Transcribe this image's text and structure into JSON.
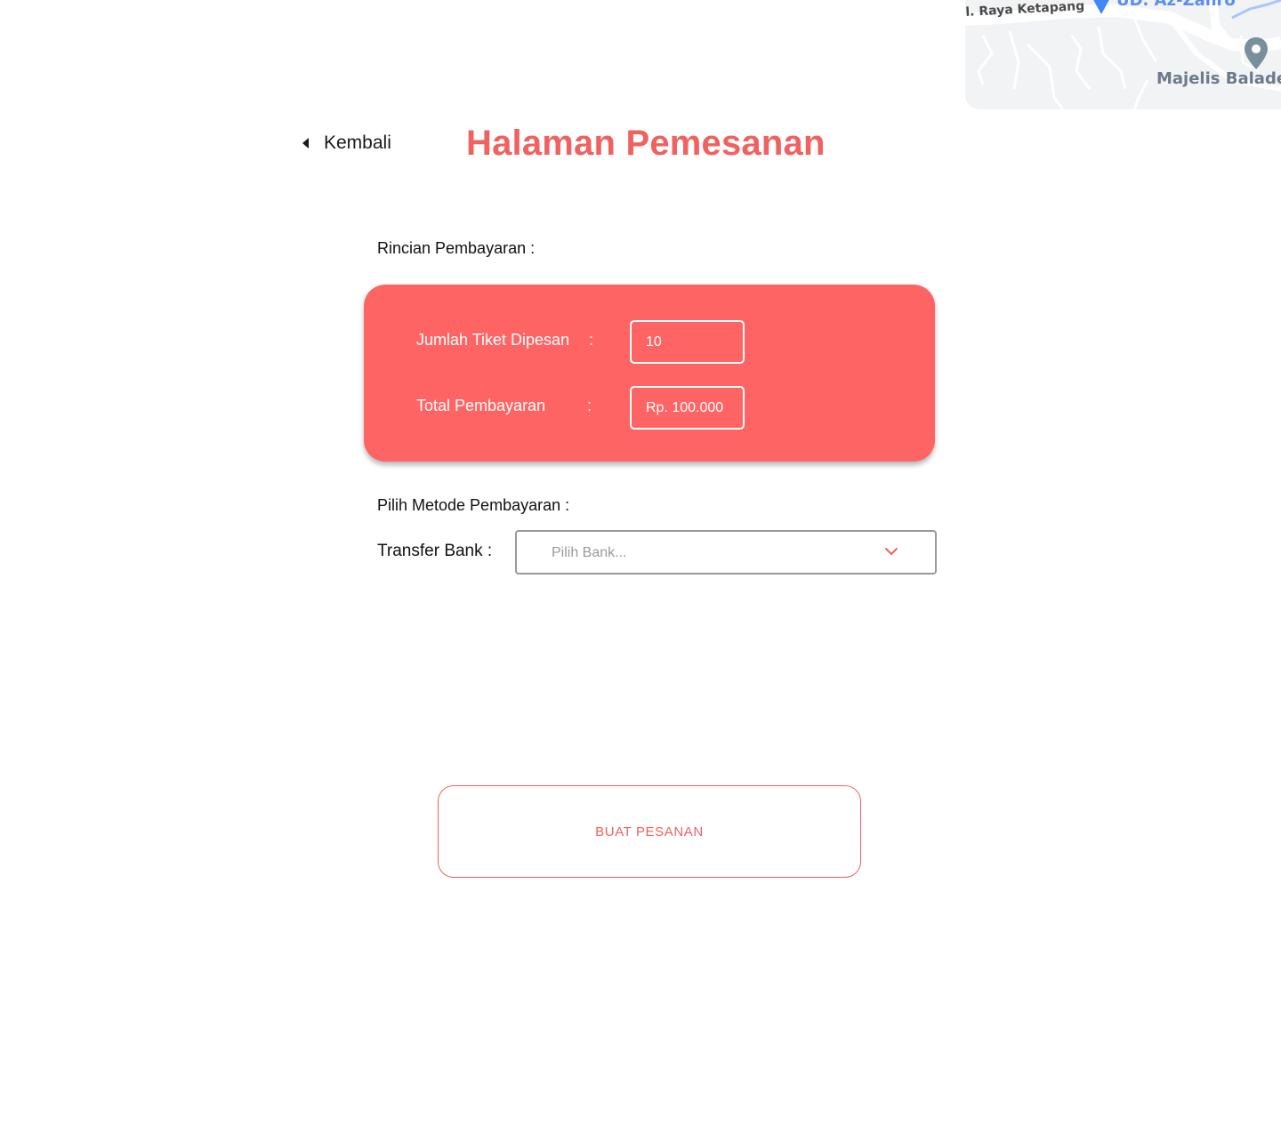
{
  "map": {
    "road_label": "l. Raya Ketapang",
    "top_place_label": "UD. Az-Zahro",
    "place_label": "Majelis Baladew",
    "pin_color": "#78909c",
    "accent_pin_color": "#4285f4"
  },
  "header": {
    "back_label": "Kembali",
    "title": "Halaman Pemesanan"
  },
  "summary": {
    "section_label": "Rincian Pembayaran :",
    "rows": [
      {
        "label": "Jumlah Tiket Dipesan",
        "colon": ":",
        "value": "10"
      },
      {
        "label": "Total Pembayaran",
        "colon": ":",
        "value": "Rp. 100.000"
      }
    ]
  },
  "payment": {
    "section_label": "Pilih Metode Pembayaran :",
    "transfer_label": "Transfer Bank :",
    "select_placeholder": "Pilih Bank..."
  },
  "actions": {
    "submit_label": "BUAT PESANAN"
  },
  "colors": {
    "accent": "#f0625f",
    "card_background": "#ff6464",
    "text": "#111111"
  }
}
